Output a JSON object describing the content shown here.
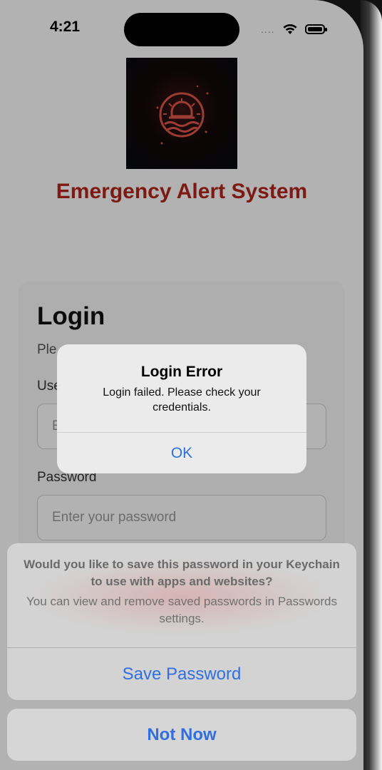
{
  "status_bar": {
    "time": "4:21",
    "signal": "....",
    "wifi_icon": "wifi-icon",
    "battery_icon": "battery-icon"
  },
  "app": {
    "logo_icon": "alert-siren-icon",
    "title": "Emergency Alert System",
    "title_color": "#b3261e"
  },
  "login": {
    "heading": "Login",
    "subtitle": "Ple",
    "username_label": "Use",
    "username_placeholder": "E",
    "password_label": "Password",
    "password_placeholder": "Enter your password"
  },
  "alert": {
    "title": "Login Error",
    "message": "Login failed. Please check your credentials.",
    "ok_label": "OK"
  },
  "keychain_sheet": {
    "title": "Would you like to save this password in your Keychain to use with apps and websites?",
    "message": "You can view and remove saved passwords in Passwords settings.",
    "save_label": "Save Password",
    "cancel_label": "Not Now"
  },
  "colors": {
    "accent": "#2f6fe0",
    "brand_red": "#b3261e"
  }
}
